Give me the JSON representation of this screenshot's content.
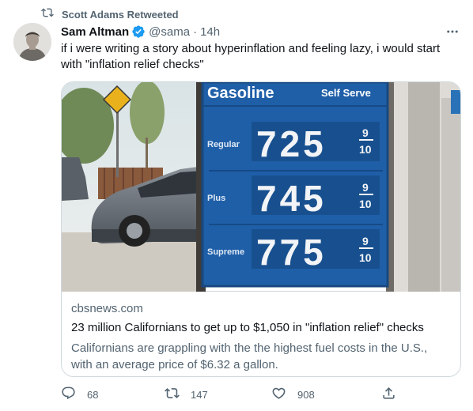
{
  "retweet": {
    "label": "Scott Adams Retweeted"
  },
  "author": {
    "name": "Sam Altman",
    "handle": "@sama",
    "separator": "·",
    "time": "14h"
  },
  "tweet": {
    "text": "if i were writing a story about hyperinflation and feeling lazy, i would start with \"inflation relief checks\""
  },
  "card": {
    "domain": "cbsnews.com",
    "title": "23 million Californians to get up to $1,050 in \"inflation relief\" checks",
    "description": "Californians are grappling with the the highest fuel costs in the U.S., with an average price of $6.32 a gallon.",
    "sign": {
      "brand": "Gasoline",
      "service": "Self Serve",
      "grades": [
        {
          "name": "Regular",
          "price": "725",
          "fraction_top": "9",
          "fraction_bottom": "10"
        },
        {
          "name": "Plus",
          "price": "745",
          "fraction_top": "9",
          "fraction_bottom": "10"
        },
        {
          "name": "Supreme",
          "price": "775",
          "fraction_top": "9",
          "fraction_bottom": "10"
        }
      ]
    }
  },
  "actions": {
    "replies": "68",
    "retweets": "147",
    "likes": "908"
  },
  "colors": {
    "accent": "#1d9bf0",
    "secondary_text": "#536471",
    "sign_blue": "#1f5fa8"
  }
}
